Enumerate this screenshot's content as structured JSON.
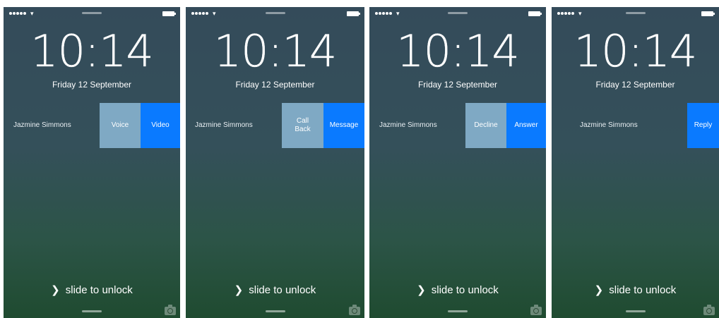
{
  "screens": [
    {
      "time": "10:14",
      "date": "Friday 12 September",
      "caller": "Jazmine Simmons",
      "actions": [
        "Voice",
        "Video"
      ],
      "slide": [
        "slide to unlock"
      ]
    },
    {
      "time": "10:14",
      "date": "Friday 12 September",
      "caller": "Jazmine Simmons",
      "actions": [
        "Call Back",
        "Message"
      ],
      "slide": [
        "slide to unlock"
      ]
    },
    {
      "time": "10:14",
      "date": "Friday 12 September",
      "caller": "Jazmine Simmons",
      "actions": [
        "Decline",
        "Answer"
      ],
      "slide": [
        "slide to unlock"
      ]
    },
    {
      "time": "10:14",
      "date": "Friday 12 September",
      "caller": "Jazmine Simmons",
      "actions": [
        "Reply"
      ],
      "slide": [
        "slide to unlock"
      ]
    }
  ],
  "icons": {
    "signal": "signal-dots-icon",
    "wifi": "wifi-icon",
    "battery": "battery-icon",
    "chevron": "chevron-right-icon",
    "camera": "camera-icon"
  },
  "colors": {
    "secondary_action": "#7fa9c4",
    "primary_action": "#0a7aff"
  }
}
